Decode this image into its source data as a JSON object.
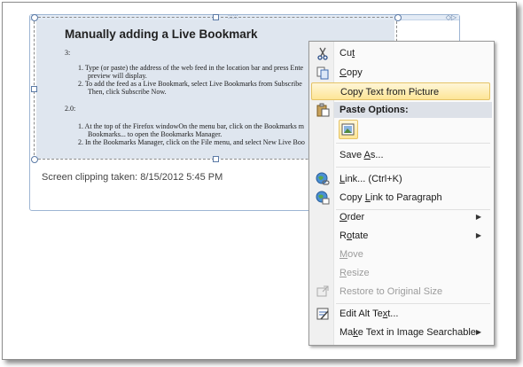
{
  "note": {
    "doc_title": "Manually adding a Live Bookmark",
    "doc_lines": [
      "3:",
      "1.  Type (or paste) the address of the web feed in the location bar and press Ente",
      "preview will display.",
      "2.  To add the feed as a Live Bookmark, select Live Bookmarks from Subscribe",
      "Then, click Subscribe Now.",
      "2.0:",
      "1.  At the top of the Firefox windowOn the menu bar, click on the Bookmarks m",
      "Bookmarks... to open the Bookmarks Manager.",
      "2.  In the Bookmarks Manager, click on the File menu, and select New Live Boo"
    ],
    "clip_caption": "Screen clipping taken:  8/15/2012 5:45 PM",
    "grip": "::::::",
    "corner": "◇▷"
  },
  "menu": {
    "items": [
      {
        "id": "cut",
        "pre": "Cu",
        "ul": "t",
        "post": "",
        "icon": "scissors-icon",
        "disabled": false,
        "arrow": false,
        "highlight": false
      },
      {
        "id": "copy",
        "pre": "",
        "ul": "C",
        "post": "opy",
        "icon": "copy-icon",
        "disabled": false,
        "arrow": false,
        "highlight": false
      },
      {
        "id": "copy-text",
        "pre": "Copy Text from Picture",
        "ul": "",
        "post": "",
        "icon": "",
        "disabled": false,
        "arrow": false,
        "highlight": true
      },
      {
        "id": "save-as",
        "pre": "Save ",
        "ul": "A",
        "post": "s...",
        "icon": "",
        "disabled": false,
        "arrow": false,
        "highlight": false
      },
      {
        "id": "link",
        "pre": "",
        "ul": "L",
        "post": "ink...   (Ctrl+K)",
        "icon": "globe-link-icon",
        "disabled": false,
        "arrow": false,
        "highlight": false
      },
      {
        "id": "copy-link",
        "pre": "Copy ",
        "ul": "L",
        "post": "ink to Paragraph",
        "icon": "link-paragraph-icon",
        "disabled": false,
        "arrow": false,
        "highlight": false
      },
      {
        "id": "order",
        "pre": "",
        "ul": "O",
        "post": "rder",
        "icon": "",
        "disabled": false,
        "arrow": true,
        "highlight": false
      },
      {
        "id": "rotate",
        "pre": "R",
        "ul": "o",
        "post": "tate",
        "icon": "",
        "disabled": false,
        "arrow": true,
        "highlight": false
      },
      {
        "id": "move",
        "pre": "",
        "ul": "M",
        "post": "ove",
        "icon": "",
        "disabled": true,
        "arrow": false,
        "highlight": false
      },
      {
        "id": "resize",
        "pre": "",
        "ul": "R",
        "post": "esize",
        "icon": "",
        "disabled": true,
        "arrow": false,
        "highlight": false
      },
      {
        "id": "restore",
        "pre": "Restore to Original Size",
        "ul": "",
        "post": "",
        "icon": "restore-size-icon",
        "disabled": true,
        "arrow": false,
        "highlight": false
      },
      {
        "id": "alt-text",
        "pre": "Edit Alt Te",
        "ul": "x",
        "post": "t...",
        "icon": "alt-text-icon",
        "disabled": false,
        "arrow": false,
        "highlight": false
      },
      {
        "id": "searchable",
        "pre": "Ma",
        "ul": "k",
        "post": "e Text in Image Searchable",
        "icon": "",
        "disabled": false,
        "arrow": true,
        "highlight": false
      }
    ],
    "paste_header": "Paste Options:",
    "paste_icon": "paste-picture-icon"
  }
}
